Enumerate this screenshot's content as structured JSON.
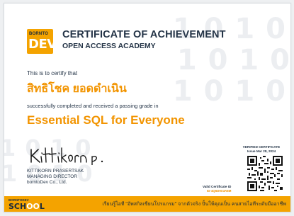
{
  "logo": {
    "line1": "BORNTO",
    "line2": "DEV"
  },
  "header": {
    "title": "CERTIFICATE OF ACHIEVEMENT",
    "subtitle": "OPEN ACCESS ACADEMY"
  },
  "body": {
    "certify_text": "This is to certify that",
    "recipient_name": "สิทธิโชค ยอดดำเนิน",
    "completed_text": "successfully completed and received a passing grade in",
    "course_name": "Essential SQL for Everyone"
  },
  "signer": {
    "signature_text": "Kittikorn p.",
    "name": "KITTIKORN PRASERTSAK",
    "role": "MANAGING DIRECTOR",
    "company": "borntoDev Co., Ltd."
  },
  "verification": {
    "heading": "VERIFIED CERTIFICATE",
    "issue_date": "Issue Mar 28, 2024",
    "id_label": "Valid Certificate ID",
    "id_value": "ID-4Q6D9X3A8M"
  },
  "footer": {
    "school_top": "BORNTODEV",
    "school_pre": "SCH",
    "school_mid": "OO",
    "school_post": "L",
    "slogan": "เรียนรู้ไอที \"อัพสกิลเขียนโปรแกรม\" จากตัวจริง ปั้นให้คุณเป็น คนสายไอทีระดับมืออาชีพ"
  },
  "colors": {
    "accent": "#f4a300",
    "accent_text": "#f29400",
    "ink": "#243447"
  }
}
